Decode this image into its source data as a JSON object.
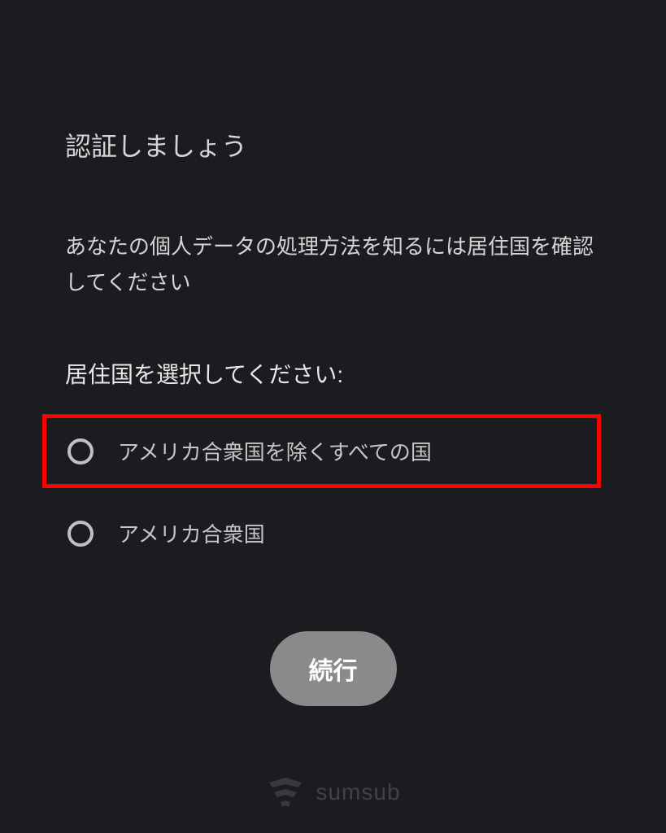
{
  "title": "認証しましょう",
  "description": "あなたの個人データの処理方法を知るには居住国を確認してください",
  "selectLabel": "居住国を選択してください:",
  "options": [
    {
      "label": "アメリカ合衆国を除くすべての国"
    },
    {
      "label": "アメリカ合衆国"
    }
  ],
  "continueButton": "続行",
  "brand": "sumsub"
}
